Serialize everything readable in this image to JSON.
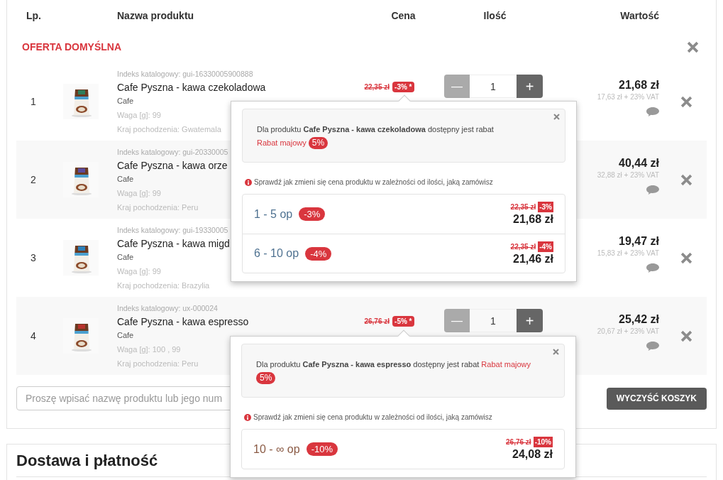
{
  "columns": [
    "Lp.",
    "Nazwa produktu",
    "Cena",
    "Ilość",
    "Wartość"
  ],
  "offer_label": "OFERTA DOMYŚLNA",
  "rows": [
    {
      "number": "1",
      "index": "Indeks katalogowy: gui-16330005900888",
      "name": "Cafe Pyszna - kawa czekoladowa",
      "category": "Cafe",
      "weight": "Waga [g]: 99",
      "origin": "Kraj pochodzenia: Gwatemala",
      "old_price": "22,35 zł",
      "discount": "-3% *",
      "quantity": "1",
      "decrease": "—",
      "increase": "+",
      "value": "21,68 zł",
      "net": "17,63 zł + 23% VAT"
    },
    {
      "number": "2",
      "index": "Indeks katalogowy: gui-20330005",
      "name": "Cafe Pyszna - kawa orze",
      "category": "Cafe",
      "weight": "Waga [g]: 99",
      "origin": "Kraj pochodzenia: Peru",
      "value": "40,44 zł",
      "net": "32,88 zł + 23% VAT"
    },
    {
      "number": "3",
      "index": "Indeks katalogowy: gui-19330005",
      "name": "Cafe Pyszna - kawa migd",
      "category": "Cafe",
      "weight": "Waga [g]: 99",
      "origin": "Kraj pochodzenia: Brazylia",
      "value": "19,47 zł",
      "net": "15,83 zł + 23% VAT"
    },
    {
      "number": "4",
      "index": "Indeks katalogowy: ux-000024",
      "name": "Cafe Pyszna - kawa espresso",
      "category": "Cafe",
      "weight": "Waga [g]: 100  , 99",
      "origin": "Kraj pochodzenia: Peru",
      "old_price": "26,76 zł",
      "discount": "-5% *",
      "quantity": "1",
      "decrease": "—",
      "increase": "+",
      "value": "25,42 zł",
      "net": "20,67 zł + 23% VAT"
    }
  ],
  "search": {
    "placeholder": "Proszę wpisać nazwę produktu lub jego num"
  },
  "clear_button": "WYCZYŚĆ KOSZYK",
  "section_title": "Dostawa i płatność",
  "popovers": [
    {
      "message": "Dla produktu **Cafe Pyszna - kawa czekoladowa** dostępny jest rabat",
      "promo_link": "Rabat majowy",
      "promo_badge": "5%",
      "hint": "Sprawdź jak zmieni się cena produktu w zależności od ilości, jaką zamówisz",
      "tiers": [
        {
          "range": "1 - 5 op",
          "badge": "-3%",
          "old_price": "22,35 zł",
          "discount": "-3%",
          "price": "21,68 zł",
          "color": "#4f7291"
        },
        {
          "range": "6 - 10 op",
          "badge": "-4%",
          "old_price": "22,35 zł",
          "discount": "-4%",
          "price": "21,46 zł",
          "color": "#4f7291"
        }
      ]
    },
    {
      "message": "Dla produktu **Cafe Pyszna - kawa espresso** dostępny jest rabat",
      "promo_link": "Rabat majowy",
      "promo_badge": "5%",
      "hint": "Sprawdź jak zmieni się cena produktu w zależności od ilości, jaką zamówisz",
      "tiers": [
        {
          "range": "10 - ∞ op",
          "badge": "-10%",
          "old_price": "26,76 zł",
          "discount": "-10%",
          "price": "24,08 zł",
          "color": "#8a5a44"
        }
      ]
    }
  ]
}
